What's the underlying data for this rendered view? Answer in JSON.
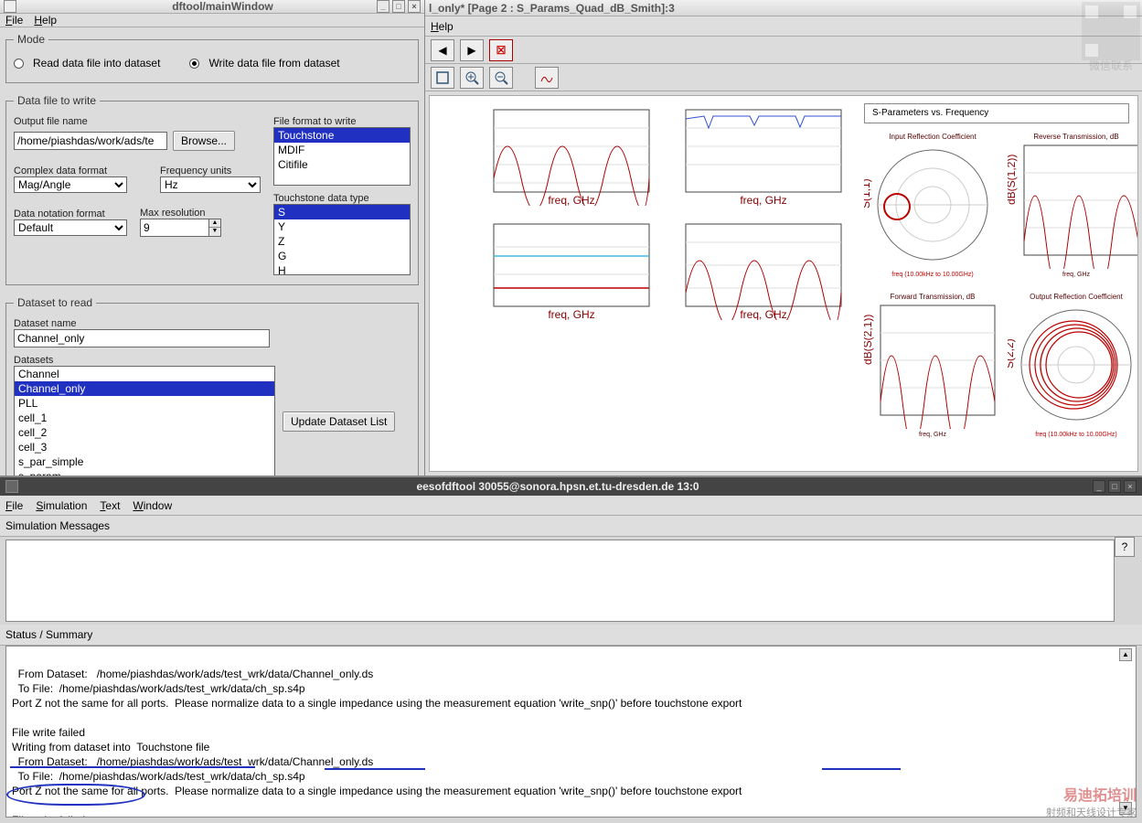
{
  "win1": {
    "title": "dftool/mainWindow",
    "menu": {
      "file": "File",
      "help": "Help"
    }
  },
  "win2": {
    "title": "l_only* [Page 2 : S_Params_Quad_dB_Smith]:3",
    "menu": {
      "help": "Help"
    }
  },
  "mode": {
    "legend": "Mode",
    "read_label": "Read data file into dataset",
    "write_label": "Write data file from dataset"
  },
  "dtw": {
    "legend": "Data file to write",
    "output_label": "Output file name",
    "output_value": "/home/piashdas/work/ads/te",
    "browse": "Browse...",
    "complex_label": "Complex data format",
    "complex_value": "Mag/Angle",
    "freq_label": "Frequency units",
    "freq_value": "Hz",
    "notation_label": "Data notation format",
    "notation_value": "Default",
    "maxres_label": "Max resolution",
    "maxres_value": "9",
    "fileformat_label": "File format to write",
    "fileformat": [
      "Touchstone",
      "MDIF",
      "Citifile"
    ],
    "tdt_label": "Touchstone data type",
    "tdt": [
      "S",
      "Y",
      "Z",
      "G",
      "H"
    ]
  },
  "dsr": {
    "legend": "Dataset to read",
    "name_label": "Dataset name",
    "name_value": "Channel_only",
    "list_label": "Datasets",
    "list": [
      "Channel",
      "Channel_only",
      "PLL",
      "cell_1",
      "cell_2",
      "cell_3",
      "s_par_simple",
      "s_param"
    ],
    "update": "Update Dataset List"
  },
  "plots": {
    "title_box": "S-Parameters vs. Frequency",
    "p1": "Input Reflection Coefficient",
    "p2": "Reverse Transmission, dB",
    "p3": "Forward Transmission, dB",
    "p4": "Output Reflection Coefficient",
    "xaxis1": "freq, GHz",
    "xaxis2": "freq, GHz",
    "smith1": "freq (10.00kHz to 10.00GHz)",
    "smith2": "freq (10.00kHz to 10.00GHz)",
    "ylab1": "S(1,1)",
    "ylab2": "dB(S(1,2))",
    "ylab3": "dB(S(2,1))",
    "ylab4": "S(2,2)"
  },
  "term": {
    "title": "eesofdftool 30055@sonora.hpsn.et.tu-dresden.de 13:0",
    "menu": {
      "file": "File",
      "sim": "Simulation",
      "text": "Text",
      "window": "Window"
    },
    "sim_label": "Simulation Messages",
    "status_label": "Status / Summary",
    "log": "  From Dataset:   /home/piashdas/work/ads/test_wrk/data/Channel_only.ds\n  To File:  /home/piashdas/work/ads/test_wrk/data/ch_sp.s4p\nPort Z not the same for all ports.  Please normalize data to a single impedance using the measurement equation 'write_snp()' before touchstone export\n\nFile write failed\nWriting from dataset into  Touchstone file\n  From Dataset:   /home/piashdas/work/ads/test_wrk/data/Channel_only.ds\n  To File:  /home/piashdas/work/ads/test_wrk/data/ch_sp.s4p\nPort Z not the same for all ports.  Please normalize data to a single impedance using the measurement equation 'write_snp()' before touchstone export\n\nFile write failed"
  },
  "qr_text": "微信联系"
}
